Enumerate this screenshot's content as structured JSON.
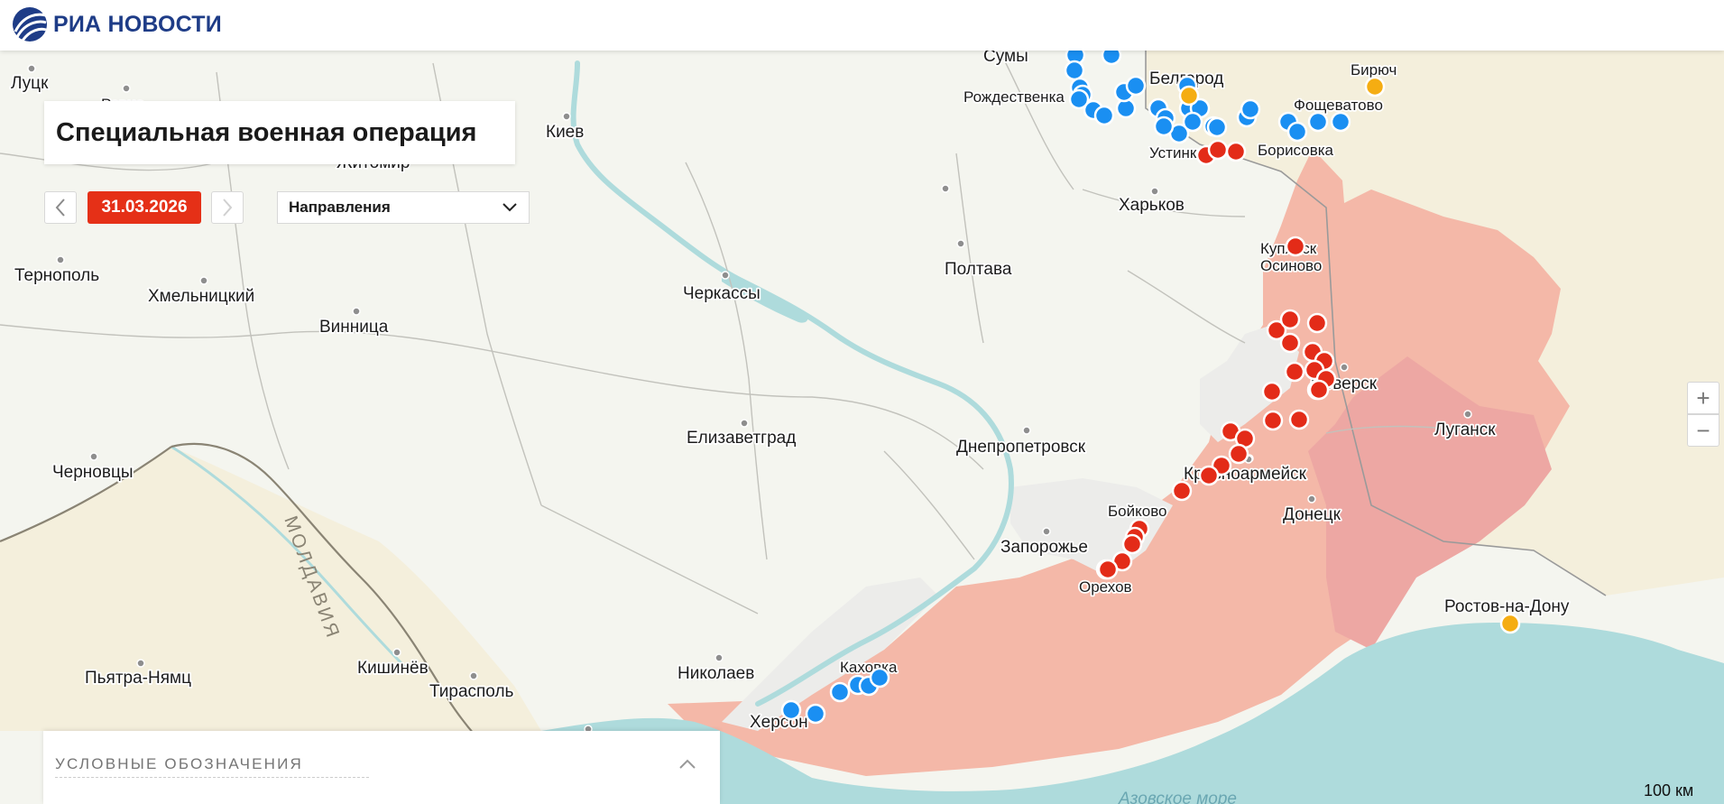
{
  "header": {
    "logo_text": "РИА НОВОСТИ",
    "logo_icon": "ria-globe-logo"
  },
  "panel": {
    "title": "Специальная военная операция",
    "date": "31.03.2026",
    "prev_icon": "chevron-left-icon",
    "next_icon": "chevron-right-icon",
    "direction_select": {
      "selected": "Направления",
      "icon": "chevron-down-icon"
    }
  },
  "zoom": {
    "in_label": "+",
    "out_label": "−"
  },
  "legend": {
    "title": "УСЛОВНЫЕ ОБОЗНАЧЕНИЯ",
    "toggle_icon": "chevron-up-icon"
  },
  "scale": {
    "label": "100 км"
  },
  "map": {
    "colors": {
      "land": "#f4f5ef",
      "foreign_land": "#f4efdc",
      "water": "#aedbdc",
      "controlled": "#f4b8a8",
      "controlled_before": "#eda7a3",
      "contested": "#ececea",
      "border": "#9a9a9a",
      "red_marker": "#e32b18",
      "blue_marker": "#1a8ff2",
      "yellow_marker": "#f5ad12"
    },
    "country_labels": [
      "МОЛДАВИЯ"
    ],
    "sea_labels": [
      "Азовское море"
    ],
    "cities": [
      "Сумы",
      "Белгород",
      "Бирюч",
      "Луцк",
      "Ровно",
      "Рождественка",
      "Фощеватово",
      "Киев",
      "Житомир",
      "Устинка",
      "Борисовка",
      "Харьков",
      "Купянск",
      "Осиново",
      "Тернополь",
      "Хмельницкий",
      "Винница",
      "Черкассы",
      "Полтава",
      "Северск",
      "Луганск",
      "Елизаветград",
      "Днепропетровск",
      "Черновцы",
      "Красноармейск",
      "Донецк",
      "Бойково",
      "Запорожье",
      "Орехов",
      "Ростов-на-Дону",
      "Кишинёв",
      "Тирасполь",
      "Пьятра-Нямц",
      "Николаев",
      "Каховка",
      "Херсон"
    ]
  }
}
